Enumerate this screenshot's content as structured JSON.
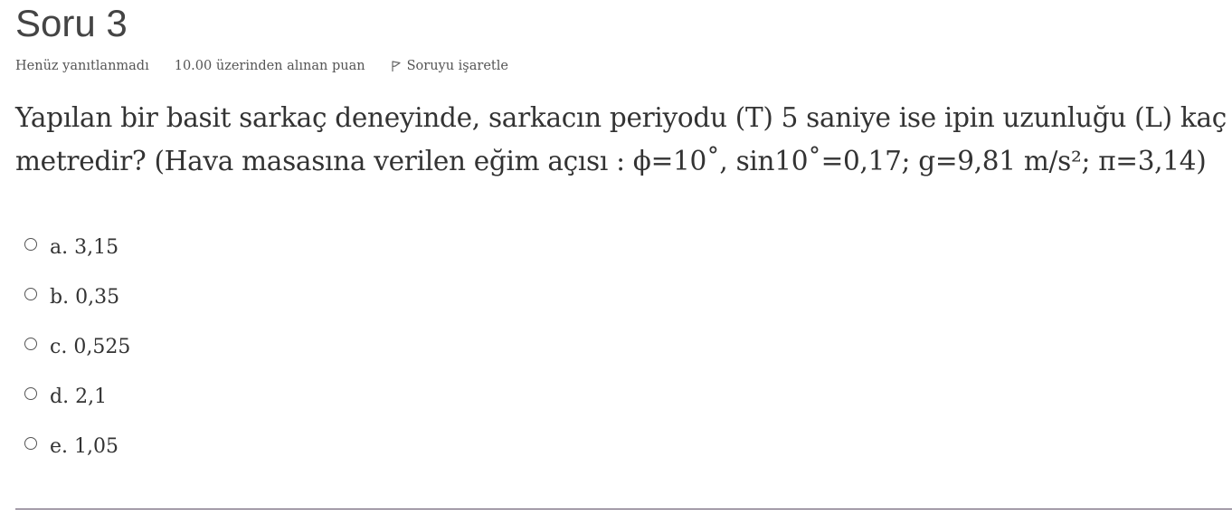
{
  "question": {
    "title": "Soru 3",
    "state": "Henüz yanıtlanmadı",
    "grade": "10.00 üzerinden alınan puan",
    "flag_label": "Soruyu işaretle",
    "text_line1": "Yapılan bir basit sarkaç deneyinde, sarkacın periyodu (T) 5 saniye ise ipin uzunluğu (L) kaç",
    "text_line2": "metredir? (Hava masasına verilen eğim açısı : ϕ=10˚, sin10˚=0,17;    g=9,81 m/s²;   π=3,14)"
  },
  "answers": [
    {
      "letter": "a.",
      "value": "3,15"
    },
    {
      "letter": "b.",
      "value": "0,35"
    },
    {
      "letter": "c.",
      "value": "0,525"
    },
    {
      "letter": "d.",
      "value": "2,1"
    },
    {
      "letter": "e.",
      "value": "1,05"
    }
  ],
  "colors": {
    "title": "#444444",
    "text": "#333333",
    "meta": "#555555",
    "divider": "#5a4b63"
  },
  "icons": {
    "flag": "flag-icon",
    "radio": "radio-button"
  }
}
